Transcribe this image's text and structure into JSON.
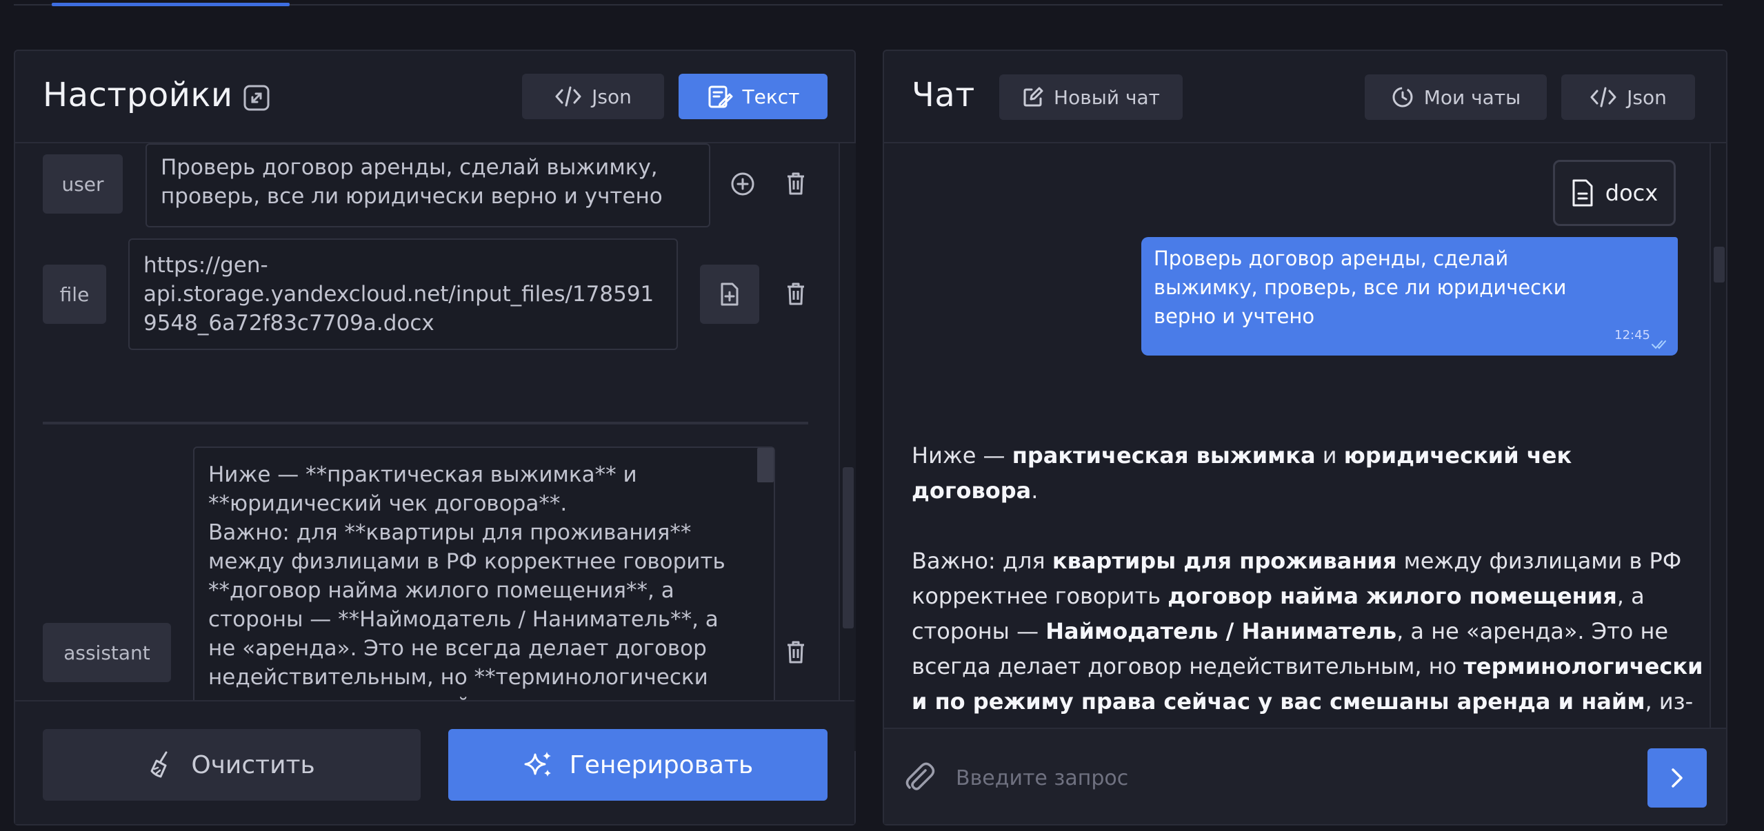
{
  "settings": {
    "title": "Настройки",
    "json_label": "Json",
    "text_label": "Текст",
    "messages": [
      {
        "role": "user",
        "content": "Проверь договор аренды, сделай выжимку,\nпроверь, все ли юридически верно и учтено"
      },
      {
        "role": "file",
        "content": "https://gen-\napi.storage.yandexcloud.net/input_files/178591\n9548_6a72f83c7709a.docx"
      },
      {
        "role": "assistant",
        "content": "Ниже — **практическая выжимка** и\n**юридический чек договора**.\nВажно: для **квартиры для проживания**\nмежду физлицами в РФ корректнее говорить\n**договор найма жилого помещения**, а\nстороны — **Наймодатель / Наниматель**, а\nне «аренда». Это не всегда делает договор\nнедействительным, но **терминологически\nи по режиму права сейчас у вас смешаны\nаренда и найм**, из-за чего есть риски по"
      }
    ],
    "clear_label": "Очистить",
    "generate_label": "Генерировать"
  },
  "chat": {
    "title": "Чат",
    "new_chat_label": "Новый чат",
    "my_chats_label": "Мои чаты",
    "json_label": "Json",
    "attachment_label": "docx",
    "user_message": "Проверь договор аренды, сделай\nвыжимку, проверь, все ли юридически\nверно и учтено",
    "user_time": "12:45",
    "reply": {
      "p1_a": "Ниже — ",
      "p1_b1": "практическая выжимка",
      "p1_c": " и ",
      "p1_b2": "юридический чек договора",
      "p1_d": ".",
      "p2_a": "Важно: для ",
      "p2_b1": "квартиры для проживания",
      "p2_c": " между физлицами в РФ корректнее говорить ",
      "p2_b2": "договор найма жилого помещения",
      "p2_d": ", а стороны — ",
      "p2_b3": "Наймодатель / Наниматель",
      "p2_e": ", а не «аренда». Это не всегда делает договор недействительным, но ",
      "p2_b4": "терминологически и по режиму права сейчас у вас смешаны аренда и найм",
      "p2_f": ", из-за чего есть риски по отдельным пунктам."
    },
    "input_placeholder": "Введите запрос"
  },
  "colors": {
    "accent": "#4a7ce8",
    "background": "#15161e",
    "panel": "#1c1e28"
  },
  "icons": [
    "expand-icon",
    "code-icon",
    "text-edit-icon",
    "edit-icon",
    "history-icon",
    "plus-circle-icon",
    "trash-icon",
    "file-add-icon",
    "document-icon",
    "broom-icon",
    "sparkles-icon",
    "paperclip-icon",
    "arrow-right-icon",
    "double-check-icon"
  ]
}
